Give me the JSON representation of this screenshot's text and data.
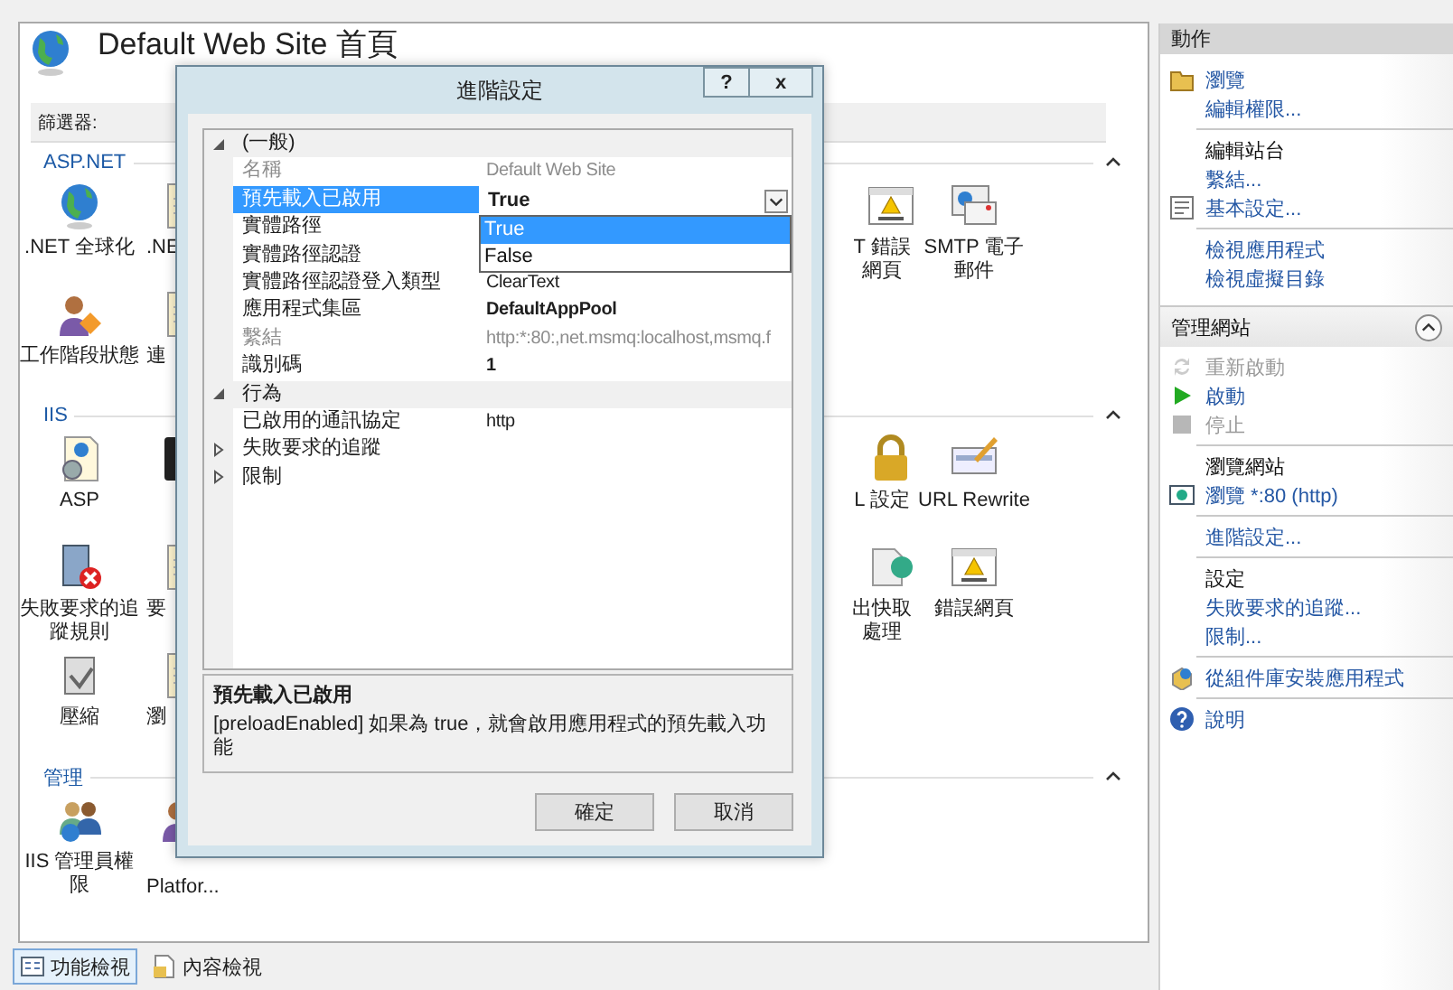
{
  "feature_view": {
    "title": "Default Web Site 首頁",
    "filter_label": "篩選器:",
    "groups": [
      {
        "label": "ASP.NET",
        "expanded": true,
        "rows": [
          [
            {
              "label": ".NET 全球化"
            },
            {
              "label": ".NE"
            },
            {
              "label": "T 錯誤網頁"
            },
            {
              "label": "SMTP 電子郵件"
            }
          ],
          [
            {
              "label": "工作階段狀態"
            },
            {
              "label": "連"
            }
          ]
        ]
      },
      {
        "label": "IIS",
        "expanded": true,
        "rows": [
          [
            {
              "label": "ASP"
            },
            {},
            {
              "label": "L 設定"
            },
            {
              "label": "URL Rewrite"
            }
          ],
          [
            {
              "label": "失敗要求的追蹤規則"
            },
            {
              "label": "要"
            },
            {
              "label": "出快取處理"
            },
            {
              "label": "錯誤網頁"
            }
          ],
          [
            {
              "label": "壓縮"
            },
            {
              "label": "瀏"
            }
          ]
        ]
      },
      {
        "label": "管理",
        "expanded": true,
        "rows": [
          [
            {
              "label": "IIS 管理員權限"
            },
            {
              "label": "Platfor..."
            }
          ]
        ]
      }
    ]
  },
  "view_tabs": [
    {
      "label": "功能檢視",
      "selected": true
    },
    {
      "label": "內容檢視",
      "selected": false
    }
  ],
  "actions": {
    "title": "動作",
    "groups": [
      {
        "items": [
          {
            "kind": "link",
            "label": "瀏覽"
          },
          {
            "kind": "link",
            "label": "編輯權限..."
          }
        ]
      },
      {
        "items": [
          {
            "kind": "heading",
            "label": "編輯站台"
          },
          {
            "kind": "link",
            "label": "繫結..."
          },
          {
            "kind": "link",
            "label": "基本設定..."
          }
        ]
      },
      {
        "items": [
          {
            "kind": "link",
            "label": "檢視應用程式"
          },
          {
            "kind": "link",
            "label": "檢視虛擬目錄"
          }
        ]
      }
    ],
    "site_section": {
      "title": "管理網站",
      "expanded": true,
      "groups": [
        {
          "items": [
            {
              "kind": "disabled",
              "label": "重新啟動"
            },
            {
              "kind": "link",
              "label": "啟動"
            },
            {
              "kind": "disabled",
              "label": "停止"
            }
          ]
        },
        {
          "items": [
            {
              "kind": "heading",
              "label": "瀏覽網站"
            },
            {
              "kind": "link",
              "label": "瀏覽 *:80 (http)"
            }
          ]
        },
        {
          "items": [
            {
              "kind": "link",
              "label": "進階設定..."
            }
          ]
        },
        {
          "items": [
            {
              "kind": "heading",
              "label": "設定"
            },
            {
              "kind": "link",
              "label": "失敗要求的追蹤..."
            },
            {
              "kind": "link",
              "label": "限制..."
            }
          ]
        },
        {
          "items": [
            {
              "kind": "link",
              "label": "從組件庫安裝應用程式"
            }
          ]
        },
        {
          "items": [
            {
              "kind": "link",
              "label": "說明"
            }
          ]
        }
      ]
    }
  },
  "dialog": {
    "title": "進階設定",
    "help_button": "?",
    "close_button": "x",
    "properties": [
      {
        "kind": "category",
        "label": "(一般)",
        "expanded": true,
        "children": [
          {
            "kind": "readonly",
            "name": "名稱",
            "value": "Default Web Site",
            "selected": false
          },
          {
            "kind": "modified",
            "name": "預先載入已啟用",
            "value": "True",
            "selected": true,
            "dropdown": [
              {
                "label": "True",
                "selected": true
              },
              {
                "label": "False",
                "selected": false
              }
            ]
          },
          {
            "kind": "plain",
            "name": "實體路徑",
            "selected": false
          },
          {
            "kind": "plain",
            "name": "實體路徑認證",
            "selected": false
          },
          {
            "kind": "plain",
            "name": "實體路徑認證登入類型",
            "value": "ClearText",
            "selected": false
          },
          {
            "kind": "modified",
            "name": "應用程式集區",
            "value": "DefaultAppPool",
            "selected": false
          },
          {
            "kind": "readonly",
            "name": "繫結",
            "value": "http:*:80:,net.msmq:localhost,msmq.f",
            "selected": false
          },
          {
            "kind": "modified",
            "name": "識別碼",
            "value": "1",
            "selected": false
          }
        ]
      },
      {
        "kind": "category",
        "label": "行為",
        "expanded": true,
        "children": [
          {
            "kind": "plain",
            "name": "已啟用的通訊協定",
            "value": "http",
            "selected": false
          },
          {
            "kind": "group",
            "name": "失敗要求的追蹤",
            "expanded": false,
            "selected": false
          },
          {
            "kind": "group",
            "name": "限制",
            "expanded": false,
            "selected": false
          }
        ]
      }
    ],
    "description": {
      "title": "預先載入已啟用",
      "text": "[preloadEnabled] 如果為 true，就會啟用應用程式的預先載入功能"
    },
    "buttons": [
      "確定",
      "取消"
    ]
  }
}
